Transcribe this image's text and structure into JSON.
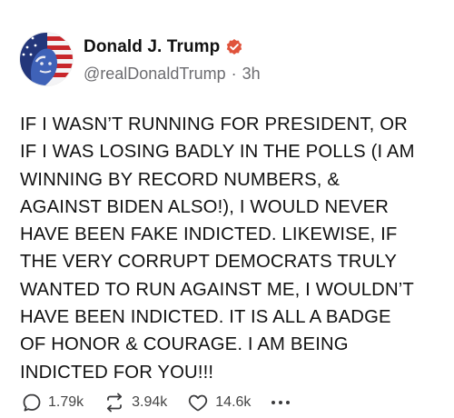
{
  "post": {
    "author": {
      "display_name": "Donald J. Trump",
      "verified": true,
      "handle": "@realDonaldTrump",
      "separator": "·",
      "time_ago": "3h"
    },
    "body_lines": [
      "IF I WASN’T RUNNING FOR PRESIDENT, OR",
      "IF I WAS LOSING BADLY IN THE POLLS (I AM",
      "WINNING BY RECORD NUMBERS, &",
      "AGAINST BIDEN ALSO!), I WOULD NEVER",
      "HAVE BEEN FAKE INDICTED. LIKEWISE, IF",
      "THE VERY CORRUPT DEMOCRATS TRULY",
      "WANTED TO RUN AGAINST ME, I WOULDN’T",
      "HAVE BEEN INDICTED. IT IS ALL A BADGE",
      "OF HONOR & COURAGE. I AM BEING",
      "INDICTED FOR YOU!!!"
    ],
    "actions": {
      "reply": {
        "icon": "reply-icon",
        "count": "1.79k"
      },
      "retruth": {
        "icon": "retruth-icon",
        "count": "3.94k"
      },
      "like": {
        "icon": "heart-icon",
        "count": "14.6k"
      },
      "more": {
        "icon": "more-icon"
      }
    }
  },
  "colors": {
    "verified_badge": "#e0533b",
    "handle_text": "#6c6c70",
    "body_text": "#121212",
    "icon": "#3a3a3c"
  }
}
